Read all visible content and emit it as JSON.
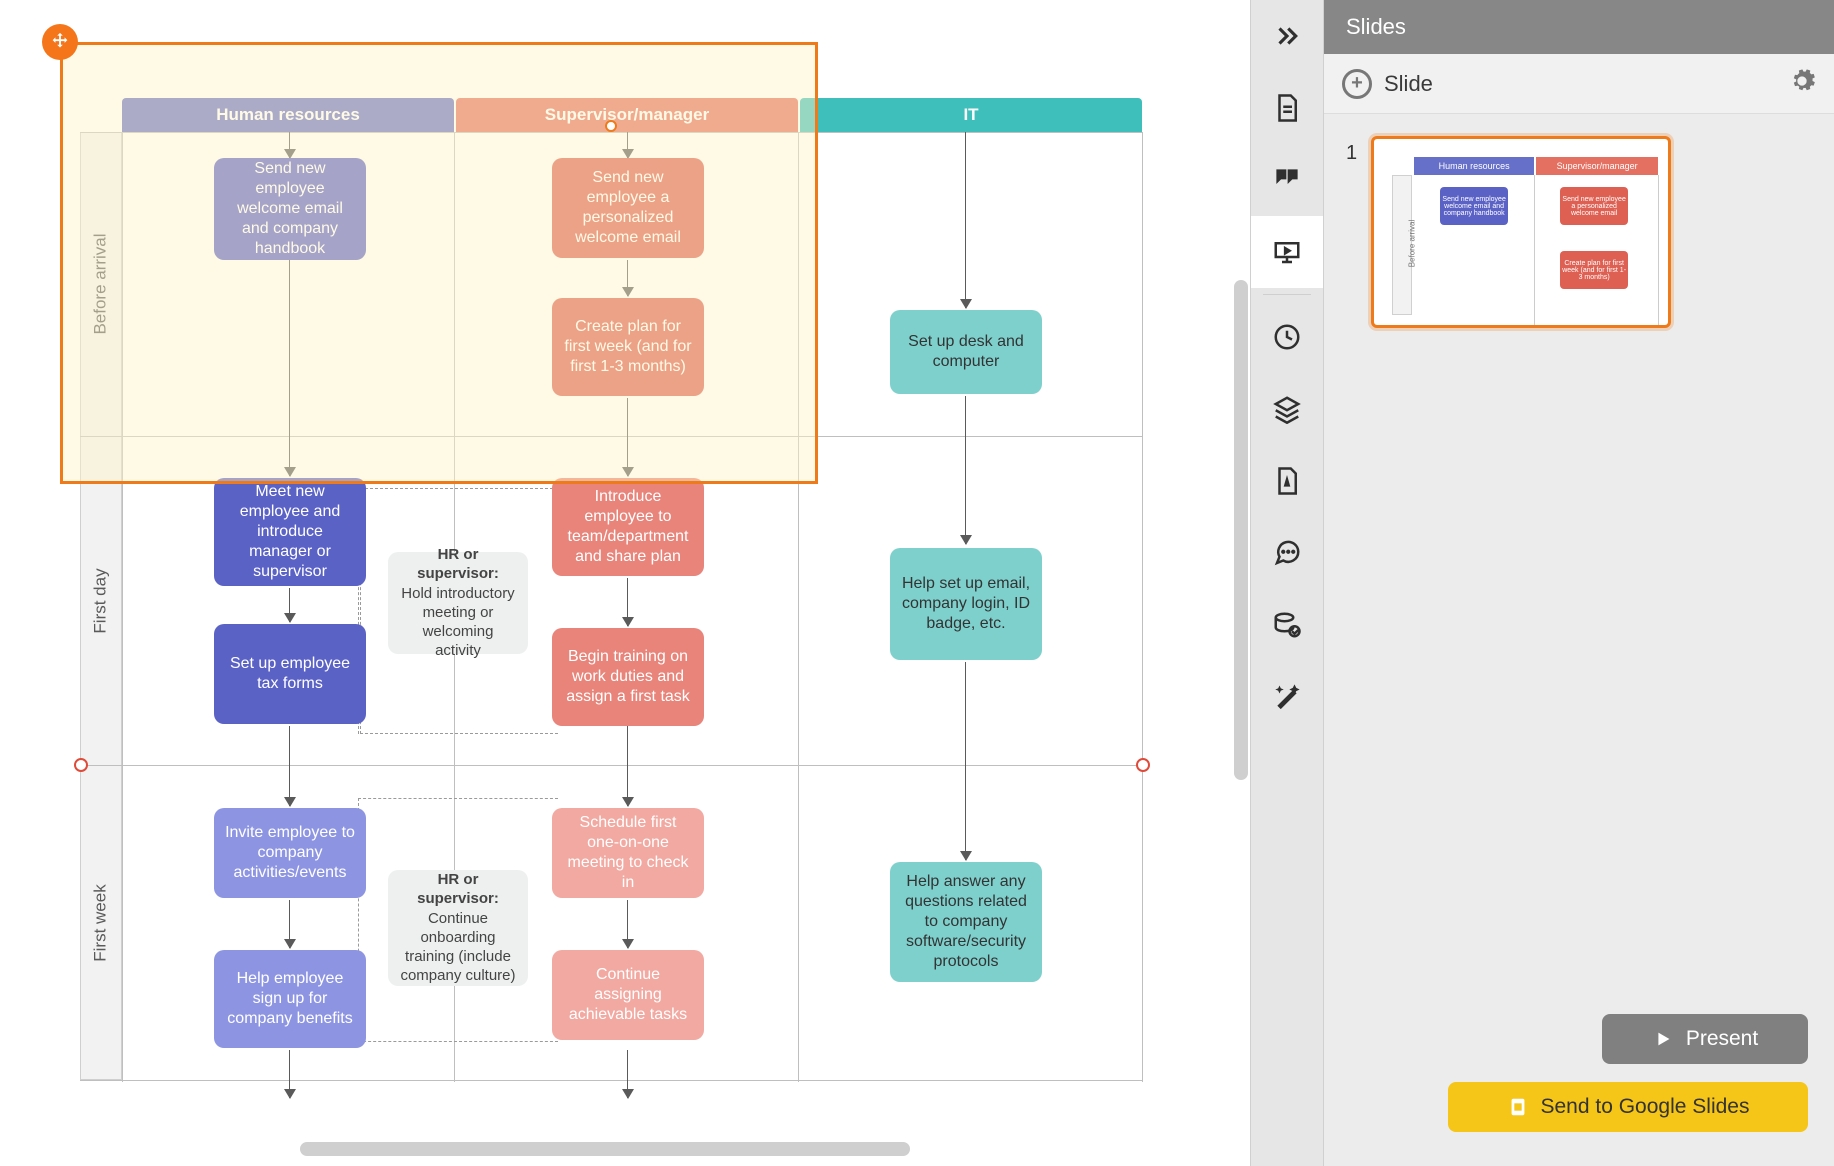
{
  "columns": {
    "hr": "Human resources",
    "sup": "Supervisor/manager",
    "it": "IT"
  },
  "rows": {
    "before": "Before arrival",
    "first_day": "First day",
    "first_week": "First week"
  },
  "cards": {
    "hr1": "Send new employee welcome email and company handbook",
    "hr2": "Meet new employee and introduce manager or supervisor",
    "hr3": "Set up employee tax forms",
    "hr4": "Invite employee to company activities/events",
    "hr5": "Help employee sign up for company benefits",
    "sup1": "Send new employee a personalized welcome email",
    "sup2": "Create plan for first week (and for first 1-3 months)",
    "sup3": "Introduce employee to team/department and share plan",
    "sup4": "Begin training on work duties and assign a first task",
    "sup5": "Schedule first one-on-one meeting to check in",
    "sup6": "Continue assigning achievable tasks",
    "it1": "Set up desk and computer",
    "it2": "Help set up email, company login, ID badge, etc.",
    "it3": "Help answer any questions related to company software/security protocols",
    "note1_title": "HR or supervisor:",
    "note1_body": "Hold introductory meeting or welcoming activity",
    "note2_title": "HR or supervisor:",
    "note2_body": "Continue onboarding training (include company culture)"
  },
  "panel": {
    "title": "Slides",
    "sub": "Slide",
    "slide_number": "1",
    "present": "Present",
    "gslides": "Send to Google Slides"
  },
  "thumb": {
    "hr": "Human resources",
    "sup": "Supervisor/manager",
    "c1": "Send new employee welcome email and company handbook",
    "c2": "Send new employee a personalized welcome email",
    "c3": "Create plan for first week (and for first 1-3 months)",
    "side": "Before arrival"
  }
}
